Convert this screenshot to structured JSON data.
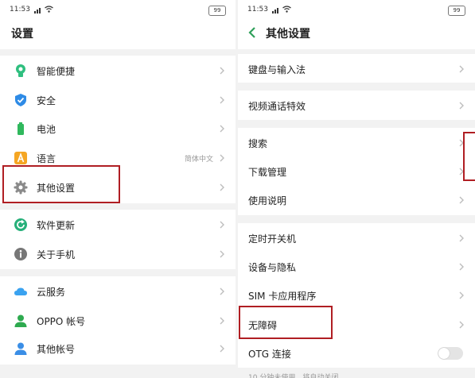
{
  "status_bar": {
    "time": "11:53",
    "battery": "99"
  },
  "left": {
    "title": "设置",
    "items": [
      {
        "label": "智能便捷"
      },
      {
        "label": "安全"
      },
      {
        "label": "电池"
      },
      {
        "label": "语言",
        "value": "简体中文"
      },
      {
        "label": "其他设置"
      },
      {
        "label": "软件更新"
      },
      {
        "label": "关于手机"
      },
      {
        "label": "云服务"
      },
      {
        "label": "OPPO 帐号"
      },
      {
        "label": "其他帐号"
      }
    ]
  },
  "right": {
    "title": "其他设置",
    "items": [
      {
        "label": "键盘与输入法"
      },
      {
        "label": "视频通话特效"
      },
      {
        "label": "搜索"
      },
      {
        "label": "下载管理"
      },
      {
        "label": "使用说明"
      },
      {
        "label": "定时开关机"
      },
      {
        "label": "设备与隐私"
      },
      {
        "label": "SIM 卡应用程序"
      },
      {
        "label": "无障碍"
      },
      {
        "label": "OTG 连接",
        "toggle_on": false
      }
    ],
    "footnote": "10 分钟未使用，将自动关闭"
  },
  "colors": {
    "highlight": "#b01e23",
    "separator": "#f2f2f2",
    "smart_icon": "#2fbf7f",
    "security_icon": "#2e8be6",
    "battery_icon": "#30b85d",
    "language_icon": "#f5a623",
    "update_icon": "#27b07a",
    "about_icon": "#777777",
    "cloud_icon": "#3aa2f0",
    "oppo_account_icon": "#2eaa4f",
    "other_account_icon": "#3a8ee6"
  },
  "icons": [
    "smart-assist-icon",
    "shield-icon",
    "battery-icon",
    "language-icon",
    "gear-icon",
    "update-icon",
    "info-icon",
    "cloud-icon",
    "person-icon",
    "person-icon",
    "back-chevron-icon",
    "chevron-right-icon"
  ]
}
